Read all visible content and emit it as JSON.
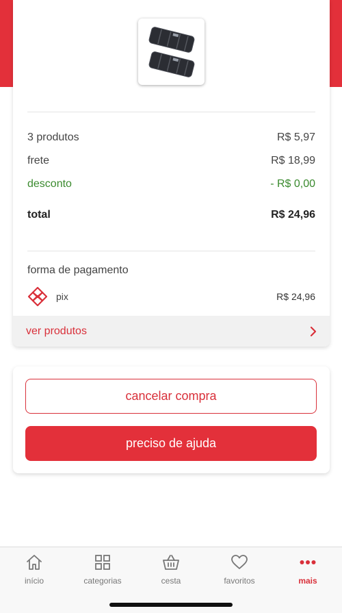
{
  "summary": {
    "products": {
      "label": "3 produtos",
      "value": "R$ 5,97"
    },
    "shipping": {
      "label": "frete",
      "value": "R$ 18,99"
    },
    "discount": {
      "label": "desconto",
      "value": "- R$ 0,00"
    },
    "total": {
      "label": "total",
      "value": "R$ 24,96"
    }
  },
  "payment": {
    "title": "forma de pagamento",
    "method": "pix",
    "amount": "R$ 24,96"
  },
  "view_products": {
    "label": "ver produtos"
  },
  "actions": {
    "cancel_label": "cancelar compra",
    "help_label": "preciso de ajuda"
  },
  "tabbar": {
    "items": [
      {
        "label": "início",
        "icon": "home-icon"
      },
      {
        "label": "categorias",
        "icon": "grid-icon"
      },
      {
        "label": "cesta",
        "icon": "basket-icon"
      },
      {
        "label": "favoritos",
        "icon": "heart-icon"
      },
      {
        "label": "mais",
        "icon": "more-icon",
        "active": true
      }
    ]
  },
  "colors": {
    "brand": "#e3303a",
    "discount": "#3a8a2e",
    "inactive_tab": "#777777"
  }
}
